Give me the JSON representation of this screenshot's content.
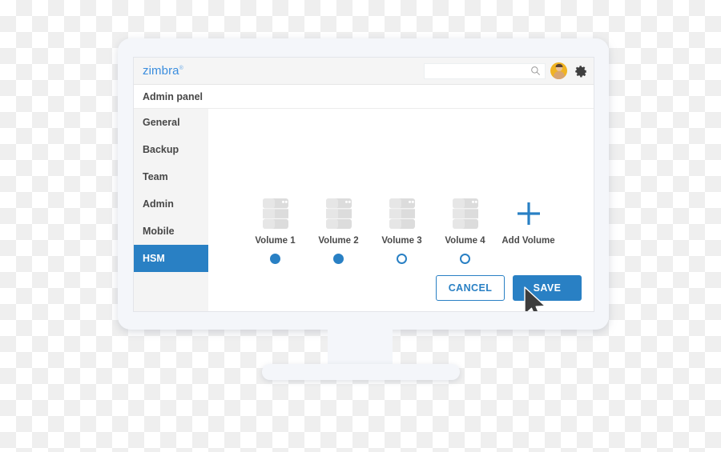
{
  "app": {
    "brand": "zimbra",
    "brand_tm": "®",
    "panel_title": "Admin panel",
    "accent_color": "#2980c4",
    "brand_color": "#3a8dde"
  },
  "header": {
    "search": {
      "value": "",
      "placeholder": "",
      "icon": "search-icon"
    },
    "avatar": {
      "icon": "user-avatar-icon",
      "color": "#f0b323"
    },
    "settings": {
      "icon": "gear-icon"
    }
  },
  "sidebar": {
    "items": [
      {
        "label": "General",
        "active": false
      },
      {
        "label": "Backup",
        "active": false
      },
      {
        "label": "Team",
        "active": false
      },
      {
        "label": "Admin",
        "active": false
      },
      {
        "label": "Mobile",
        "active": false
      },
      {
        "label": "HSM",
        "active": true
      }
    ]
  },
  "main": {
    "volumes": [
      {
        "label": "Volume 1",
        "icon": "server-stack-icon",
        "selected": true,
        "has_radio": true
      },
      {
        "label": "Volume 2",
        "icon": "server-stack-icon",
        "selected": true,
        "has_radio": true
      },
      {
        "label": "Volume 3",
        "icon": "server-stack-icon",
        "selected": false,
        "has_radio": true
      },
      {
        "label": "Volume 4",
        "icon": "server-stack-icon",
        "selected": false,
        "has_radio": true
      },
      {
        "label": "Add Volume",
        "icon": "plus-icon",
        "selected": false,
        "has_radio": false
      }
    ],
    "actions": {
      "cancel_label": "CANCEL",
      "save_label": "SAVE"
    }
  },
  "cursor": {
    "icon": "mouse-pointer-icon",
    "hover_target": "Volume 3"
  }
}
